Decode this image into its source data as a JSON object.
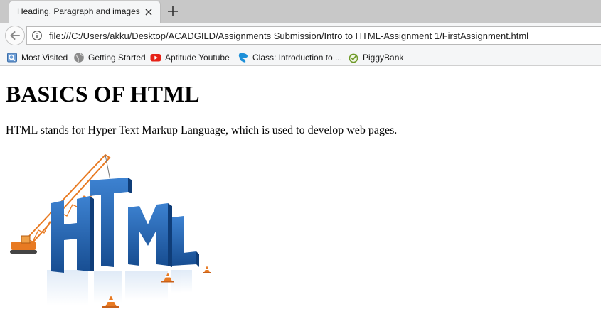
{
  "tab": {
    "title": "Heading, Paragraph and images"
  },
  "url": "file:///C:/Users/akku/Desktop/ACADGILD/Assignments Submission/Intro to HTML-Assignment 1/FirstAssignment.html",
  "bookmarks": [
    {
      "label": "Most Visited",
      "icon": "most-visited-icon"
    },
    {
      "label": "Getting Started",
      "icon": "globe-icon"
    },
    {
      "label": "Aptitude Youtube",
      "icon": "youtube-icon"
    },
    {
      "label": "Class: Introduction to ...",
      "icon": "edureka-icon"
    },
    {
      "label": "PiggyBank",
      "icon": "piggybank-icon"
    }
  ],
  "page": {
    "heading": "BASICS OF HTML",
    "paragraph": "HTML stands for Hyper Text Markup Language, which is used to develop web pages.",
    "image_text": "HTML"
  },
  "colors": {
    "html_blue": "#1f5fae",
    "crane_orange": "#e87a22"
  }
}
